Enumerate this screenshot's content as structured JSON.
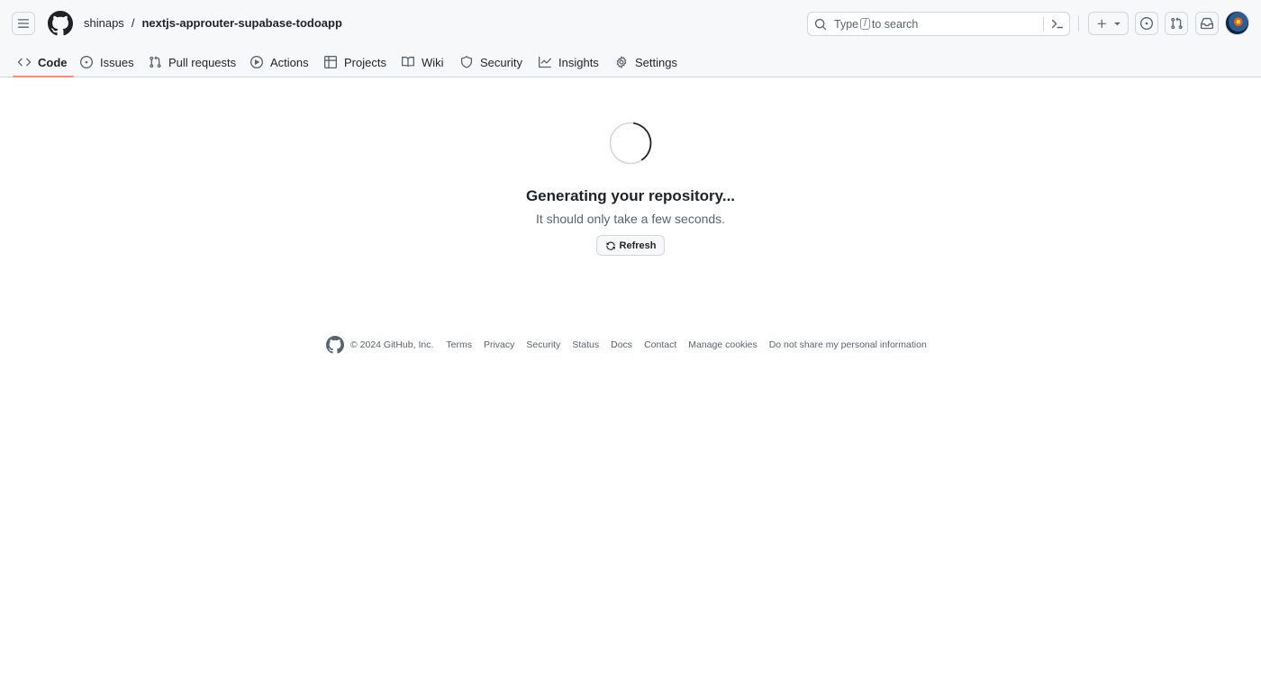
{
  "header": {
    "owner": "shinaps",
    "separator": "/",
    "repo": "nextjs-approuter-supabase-todoapp",
    "search": {
      "prefix": "Type",
      "key": "/",
      "suffix": "to search"
    }
  },
  "tabs": [
    {
      "label": "Code",
      "icon": "code-icon",
      "active": true
    },
    {
      "label": "Issues",
      "icon": "issue-opened-icon"
    },
    {
      "label": "Pull requests",
      "icon": "git-pull-request-icon"
    },
    {
      "label": "Actions",
      "icon": "play-icon"
    },
    {
      "label": "Projects",
      "icon": "table-icon"
    },
    {
      "label": "Wiki",
      "icon": "book-icon"
    },
    {
      "label": "Security",
      "icon": "shield-icon"
    },
    {
      "label": "Insights",
      "icon": "graph-icon"
    },
    {
      "label": "Settings",
      "icon": "gear-icon"
    }
  ],
  "main": {
    "title": "Generating your repository...",
    "subtitle": "It should only take a few seconds.",
    "refresh_label": "Refresh"
  },
  "footer": {
    "copyright": "© 2024 GitHub, Inc.",
    "links": [
      "Terms",
      "Privacy",
      "Security",
      "Status",
      "Docs",
      "Contact",
      "Manage cookies",
      "Do not share my personal information"
    ]
  },
  "colors": {
    "active_tab_underline": "#fd8c73",
    "header_bg": "#f6f8fa",
    "border": "#d0d7de",
    "muted_text": "#59636e"
  }
}
